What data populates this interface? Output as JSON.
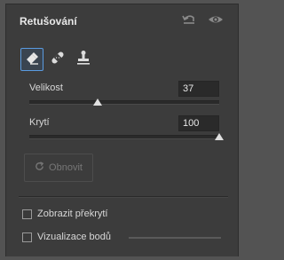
{
  "panel": {
    "title": "Retušování",
    "header_icons": [
      "undo-icon",
      "eye-icon"
    ]
  },
  "tools": [
    {
      "name": "eraser-tool",
      "icon": "eraser-icon",
      "active": true
    },
    {
      "name": "bandage-tool",
      "icon": "bandage-icon",
      "active": false
    },
    {
      "name": "clone-stamp-tool",
      "icon": "stamp-icon",
      "active": false
    }
  ],
  "controls": {
    "size": {
      "label": "Velikost",
      "value": "37",
      "fraction": 0.36
    },
    "opacity": {
      "label": "Krytí",
      "value": "100",
      "fraction": 1.0
    }
  },
  "reset": {
    "label": "Obnovit",
    "icon": "refresh-icon",
    "enabled": false
  },
  "options": [
    {
      "label": "Zobrazit překrytí",
      "checked": false
    },
    {
      "label": "Vizualizace bodů",
      "checked": false
    }
  ],
  "colors": {
    "panel_bg": "#3c3c3c",
    "accent": "#5a9be0",
    "text": "#d8d8d8"
  }
}
